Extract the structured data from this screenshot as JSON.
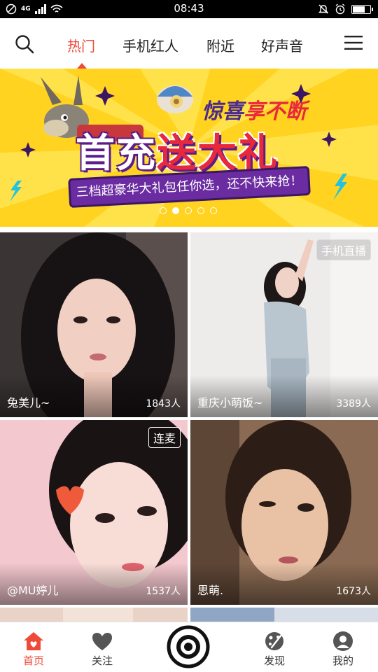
{
  "status_bar": {
    "time": "08:43",
    "network": "4G",
    "battery_level": 0.7,
    "left_icons": [
      "do-not-disturb-icon",
      "signal-icon",
      "wifi-icon"
    ],
    "right_icons": [
      "silent-bell-icon",
      "alarm-icon",
      "battery-icon"
    ]
  },
  "top_nav": {
    "tabs": [
      {
        "label": "热门",
        "active": true
      },
      {
        "label": "手机红人",
        "active": false
      },
      {
        "label": "附近",
        "active": false
      },
      {
        "label": "好声音",
        "active": false
      }
    ],
    "accent_color": "#ee4a3a"
  },
  "banner": {
    "subtitle_part1": "惊喜",
    "subtitle_part2": "享不断",
    "title_part1": "首充",
    "title_part2": "送大礼",
    "ribbon_text": "三档超豪华大礼包任你选，还不快来抢！",
    "current_slide": 2,
    "total_slides": 5
  },
  "streams": [
    {
      "name": "兔美儿~",
      "viewers": "1843人",
      "tag": ""
    },
    {
      "name": "重庆小萌饭~",
      "viewers": "3389人",
      "tag": "手机直播"
    },
    {
      "name": "@MU婷儿",
      "viewers": "1537人",
      "tag": "连麦"
    },
    {
      "name": "思萌.",
      "viewers": "1673人",
      "tag": ""
    }
  ],
  "bottom_nav": {
    "items": [
      {
        "label": "首页",
        "icon": "home-icon",
        "active": true
      },
      {
        "label": "关注",
        "icon": "heart-icon",
        "active": false
      },
      {
        "label": "",
        "icon": "camera-icon",
        "active": false
      },
      {
        "label": "发现",
        "icon": "discover-icon",
        "active": false
      },
      {
        "label": "我的",
        "icon": "profile-icon",
        "active": false
      }
    ]
  }
}
